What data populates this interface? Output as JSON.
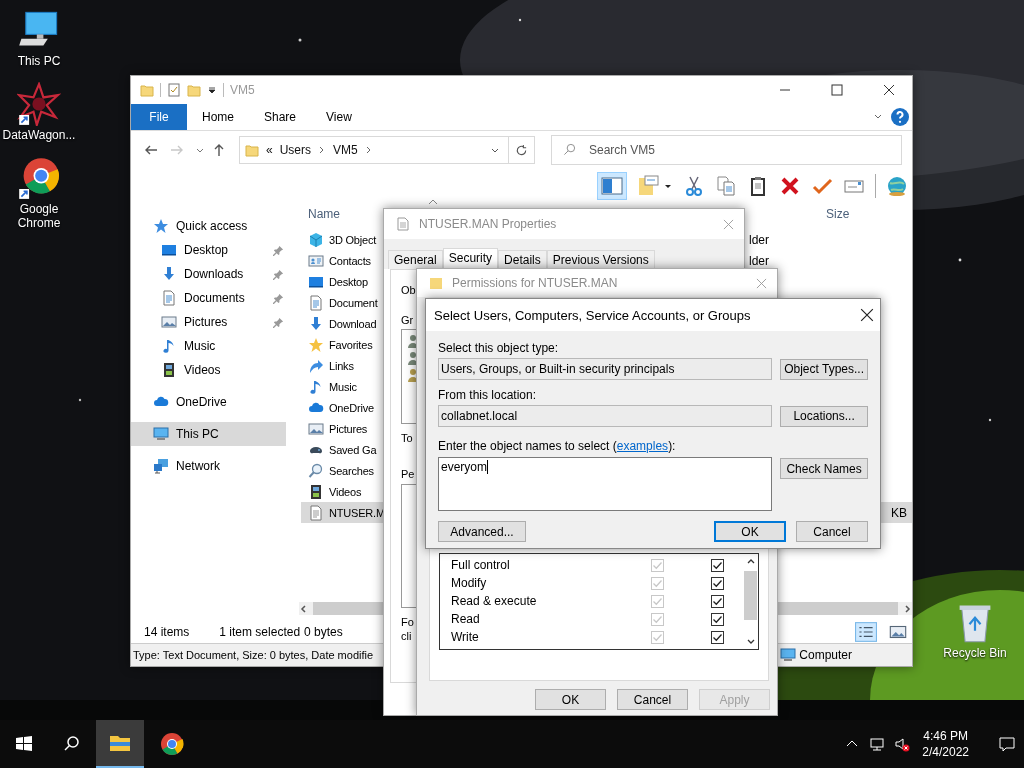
{
  "desktop_icons": [
    {
      "label": "This PC",
      "kind": "pc"
    },
    {
      "label": "DataWagon...",
      "kind": "app"
    },
    {
      "label": "Google Chrome",
      "kind": "chrome"
    }
  ],
  "recycle_bin": {
    "label": "Recycle Bin"
  },
  "explorer": {
    "title": "VM5",
    "file_tab": "File",
    "ribbon_tabs": [
      "Home",
      "Share",
      "View"
    ],
    "breadcrumb_overflow": "«",
    "breadcrumb": [
      "Users",
      "VM5"
    ],
    "search": {
      "placeholder": "Search VM5"
    },
    "nav": [
      {
        "label": "Quick access",
        "kind": "star",
        "selected": false,
        "children": [
          {
            "label": "Desktop",
            "kind": "desktop",
            "pinned": true,
            "selected": false
          },
          {
            "label": "Downloads",
            "kind": "download",
            "pinned": true,
            "selected": false
          },
          {
            "label": "Documents",
            "kind": "document",
            "pinned": true,
            "selected": false
          },
          {
            "label": "Pictures",
            "kind": "picture",
            "pinned": true,
            "selected": false
          },
          {
            "label": "Music",
            "kind": "music",
            "pinned": false,
            "selected": false
          },
          {
            "label": "Videos",
            "kind": "film",
            "pinned": false,
            "selected": false
          }
        ]
      },
      {
        "label": "OneDrive",
        "kind": "cloud",
        "selected": false
      },
      {
        "label": "This PC",
        "kind": "pc",
        "selected": true
      },
      {
        "label": "Network",
        "kind": "network",
        "selected": false
      }
    ],
    "columns": {
      "name": "Name",
      "size": "Size"
    },
    "files": [
      {
        "name": "3D Object",
        "kind": "cube",
        "selected": false,
        "column_3": "lder"
      },
      {
        "name": "Contacts",
        "kind": "contact",
        "selected": false,
        "column_3": "lder"
      },
      {
        "name": "Desktop",
        "kind": "desktop",
        "selected": false
      },
      {
        "name": "Document",
        "kind": "document",
        "selected": false
      },
      {
        "name": "Download",
        "kind": "download",
        "selected": false
      },
      {
        "name": "Favorites",
        "kind": "favstar",
        "selected": false
      },
      {
        "name": "Links",
        "kind": "link",
        "selected": false
      },
      {
        "name": "Music",
        "kind": "music",
        "selected": false
      },
      {
        "name": "OneDrive",
        "kind": "cloud",
        "selected": false
      },
      {
        "name": "Pictures",
        "kind": "picture",
        "selected": false
      },
      {
        "name": "Saved Ga",
        "kind": "gamepad",
        "selected": false
      },
      {
        "name": "Searches",
        "kind": "search",
        "selected": false
      },
      {
        "name": "Videos",
        "kind": "film",
        "selected": false
      },
      {
        "name": "NTUSER.M",
        "kind": "text",
        "selected": true,
        "size": "KB"
      }
    ],
    "item_count": "14 items",
    "selection_count": "1 item selected",
    "selection_size": "0 bytes",
    "details": "Type: Text Document, Size: 0 bytes, Date modifie",
    "details_location": "Computer"
  },
  "properties": {
    "title": "NTUSER.MAN Properties",
    "tabs": [
      {
        "label": "General",
        "selected": false
      },
      {
        "label": "Security",
        "selected": true
      },
      {
        "label": "Details",
        "selected": false
      },
      {
        "label": "Previous Versions",
        "selected": false
      }
    ],
    "fragments": [
      "Ob",
      "Gr",
      "To",
      "Pe"
    ],
    "footer_fragments": [
      "Fo",
      "cli"
    ]
  },
  "permissions": {
    "title": "Permissions for NTUSER.MAN",
    "rows": [
      {
        "label": "Full control",
        "allow_checked": true,
        "allow_disabled": true,
        "deny_checked": true
      },
      {
        "label": "Modify",
        "allow_checked": true,
        "allow_disabled": true,
        "deny_checked": true
      },
      {
        "label": "Read & execute",
        "allow_checked": true,
        "allow_disabled": true,
        "deny_checked": true
      },
      {
        "label": "Read",
        "allow_checked": true,
        "allow_disabled": true,
        "deny_checked": true
      },
      {
        "label": "Write",
        "allow_checked": true,
        "allow_disabled": true,
        "deny_checked": true
      }
    ],
    "buttons": [
      {
        "label": "OK",
        "disabled": false
      },
      {
        "label": "Cancel",
        "disabled": false
      },
      {
        "label": "Apply",
        "disabled": true
      }
    ]
  },
  "select_dialog": {
    "title": "Select Users, Computers, Service Accounts, or Groups",
    "object_type_label": "Select this object type:",
    "object_type_value": "Users, Groups, or Built-in security principals",
    "object_types_button": "Object Types...",
    "location_label": "From this location:",
    "location_value": "collabnet.local",
    "locations_button": "Locations...",
    "names_label_before": "Enter the object names to select (",
    "names_label_link": "examples",
    "names_label_after": "):",
    "names_value": "everyom",
    "check_names_button": "Check Names",
    "advanced_button": "Advanced...",
    "buttons": [
      {
        "label": "OK",
        "default": true
      },
      {
        "label": "Cancel",
        "default": false
      }
    ]
  },
  "taskbar": {
    "apps": [
      {
        "kind": "explorer",
        "active": true
      },
      {
        "kind": "chrome",
        "active": false
      }
    ],
    "time": "4:46 PM",
    "date": "2/4/2022"
  }
}
